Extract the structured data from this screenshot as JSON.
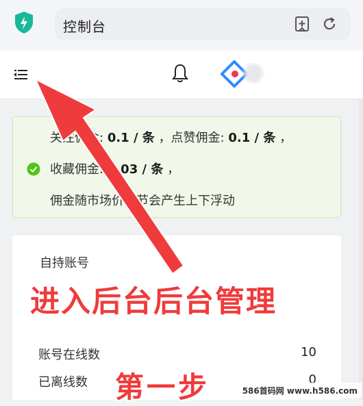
{
  "browser": {
    "url_text": "控制台"
  },
  "toolbar": {
    "menu_icon": "collapse-menu-icon",
    "bell_icon": "bell-icon",
    "logo_icon": "app-logo-icon"
  },
  "notice": {
    "line1_part1": "关注佣金:",
    "line1_value1": "0.1 / 条",
    "line1_sep": "，点赞佣金:",
    "line1_value2": "0.1 / 条",
    "line1_end": "，",
    "line2_label": "收藏佣金:",
    "line2_value": "0.03 / 条",
    "line2_end": "，",
    "line3": "佣金随市场价调节会产生上下浮动"
  },
  "card": {
    "title": "自持账号",
    "stats": [
      {
        "label": "账号在线数",
        "value": "10"
      },
      {
        "label": "已离线数",
        "value": "0"
      }
    ]
  },
  "annotation": {
    "headline": "进入后台后台管理",
    "step": "第一步",
    "arrow_color": "#ef3b3b"
  },
  "watermark": "586首码网 www.h586.com",
  "colors": {
    "accent_green": "#19b89a",
    "notice_bg": "#f1f8ea",
    "check_green": "#52c41a",
    "logo_blue": "#2f8cff",
    "logo_red": "#e8384f"
  }
}
